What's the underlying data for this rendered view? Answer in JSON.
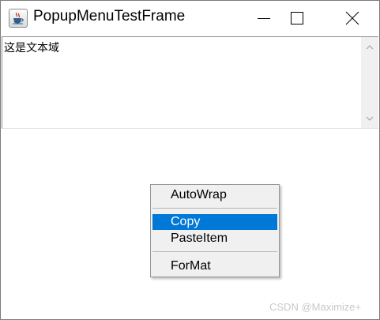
{
  "window": {
    "title": "PopupMenuTestFrame",
    "icon": "java-coffee-cup-icon",
    "controls": [
      "minimize-icon",
      "maximize-icon",
      "close-icon"
    ]
  },
  "textarea": {
    "text": "这是文本域"
  },
  "popup_menu": {
    "items": [
      {
        "label": "AutoWrap",
        "selected": false
      },
      {
        "label": "Copy",
        "selected": true
      },
      {
        "label": "PasteItem",
        "selected": false
      },
      {
        "label": "ForMat",
        "selected": false
      }
    ]
  },
  "watermark": {
    "text": "CSDN @Maximize+"
  },
  "colors": {
    "selection": "#0078d7",
    "menu_background": "#f0f0f0",
    "scrollbar_track": "#f0f0f0"
  }
}
